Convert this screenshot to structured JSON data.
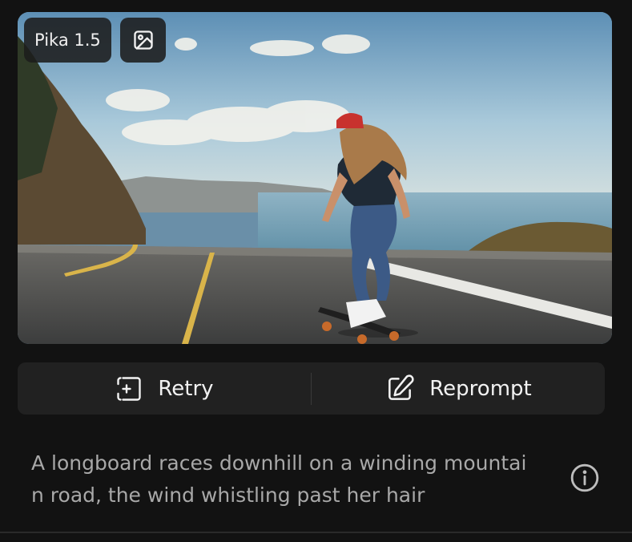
{
  "media": {
    "model_badge": "Pika 1.5",
    "image_icon": "image-icon"
  },
  "actions": {
    "retry_label": "Retry",
    "retry_icon": "add-frame-icon",
    "reprompt_label": "Reprompt",
    "reprompt_icon": "edit-icon"
  },
  "prompt": {
    "text": "A longboard races downhill on a winding mountain road, the wind whistling past her hair",
    "info_icon": "info-icon"
  },
  "colors": {
    "background": "#121212",
    "action_bar": "#212121",
    "prompt_text": "#a8a8a8",
    "label_text": "#f2f2f2"
  }
}
